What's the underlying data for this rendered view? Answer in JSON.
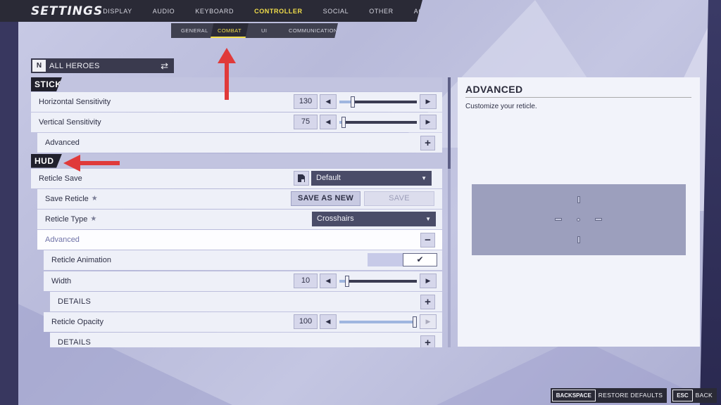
{
  "nav": {
    "title": "SETTINGS",
    "tabs": [
      {
        "label": "DISPLAY",
        "active": false
      },
      {
        "label": "AUDIO",
        "active": false
      },
      {
        "label": "KEYBOARD",
        "active": false
      },
      {
        "label": "CONTROLLER",
        "active": true
      },
      {
        "label": "SOCIAL",
        "active": false
      },
      {
        "label": "OTHER",
        "active": false
      },
      {
        "label": "ACCESSIBILITY",
        "active": false
      }
    ],
    "subtabs": [
      {
        "label": "GENERAL",
        "active": false
      },
      {
        "label": "COMBAT",
        "active": true
      },
      {
        "label": "UI",
        "active": false
      },
      {
        "label": "COMMUNICATION",
        "active": false
      }
    ]
  },
  "hero_select": {
    "label": "ALL HEROES",
    "swap_icon": "swap-arrows-icon"
  },
  "sections": {
    "stick": "STICK",
    "hud": "HUD"
  },
  "rows": {
    "horizontal_sensitivity": {
      "label": "Horizontal Sensitivity",
      "value": "130",
      "level": 0.15
    },
    "vertical_sensitivity": {
      "label": "Vertical Sensitivity",
      "value": "75",
      "level": 0.03
    },
    "stick_advanced": {
      "label": "Advanced"
    },
    "reticle_save": {
      "label": "Reticle Save",
      "dropdown": "Default"
    },
    "save_reticle": {
      "label": "Save Reticle",
      "save_as_new": "SAVE AS NEW",
      "save": "SAVE"
    },
    "reticle_type": {
      "label": "Reticle Type",
      "dropdown": "Crosshairs"
    },
    "hud_advanced": {
      "label": "Advanced"
    },
    "reticle_animation": {
      "label": "Reticle Animation",
      "checked": true
    },
    "width": {
      "label": "Width",
      "value": "10",
      "level": 0.08
    },
    "width_details": {
      "label": "DETAILS"
    },
    "reticle_opacity": {
      "label": "Reticle Opacity",
      "value": "100",
      "level": 1.0
    },
    "opacity_details": {
      "label": "DETAILS"
    }
  },
  "info": {
    "title": "ADVANCED",
    "description": "Customize your reticle."
  },
  "bottom": {
    "restore_key": "BACKSPACE",
    "restore_label": "RESTORE DEFAULTS",
    "back_key": "ESC",
    "back_label": "BACK"
  },
  "colors": {
    "accent": "#f3df4a",
    "annotation_arrow": "#e03a3a",
    "dropdown_bg": "#4a4c68",
    "slider_fill": "#9fb6df"
  }
}
